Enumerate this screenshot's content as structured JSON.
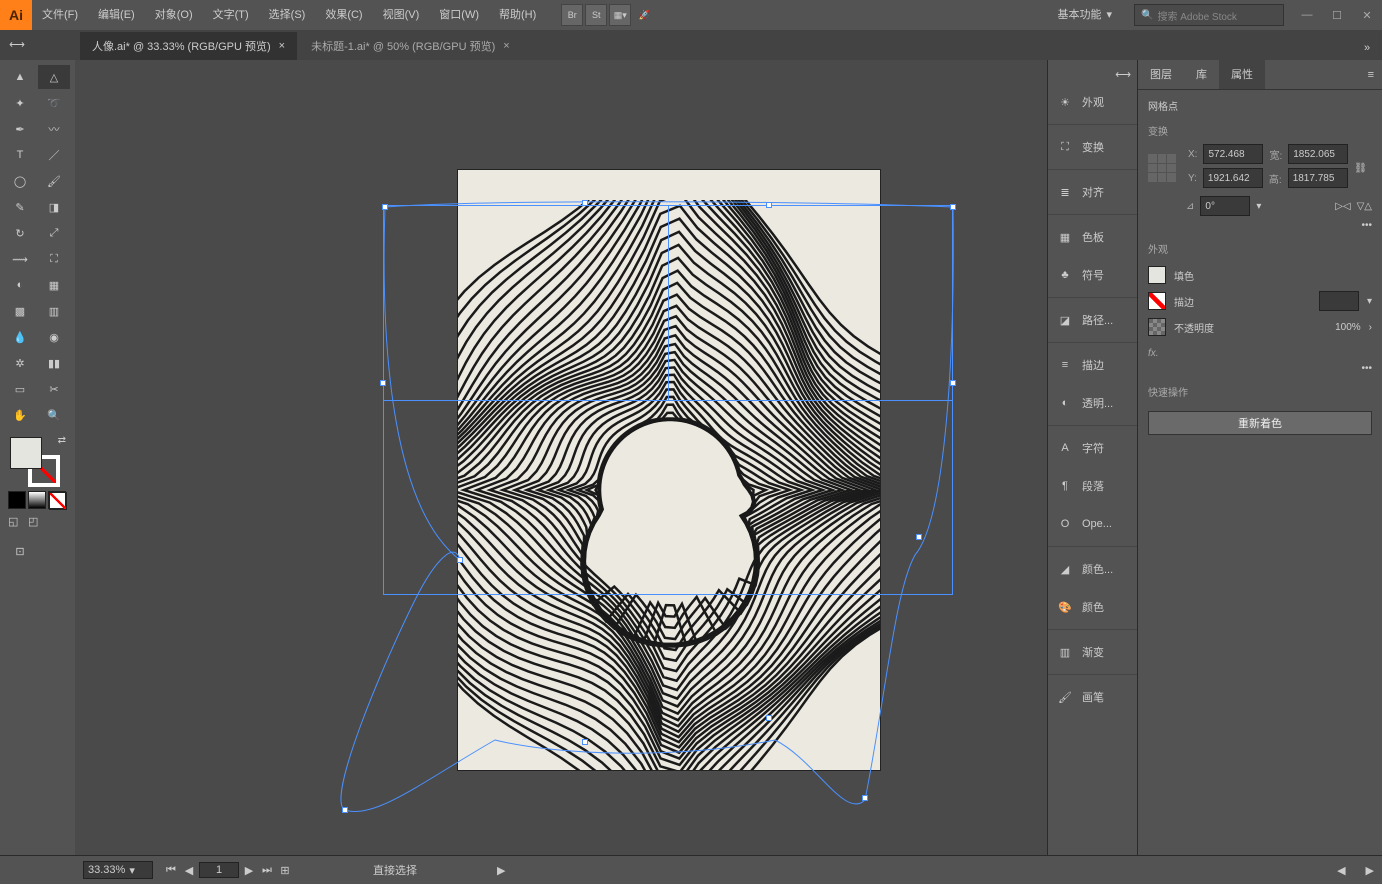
{
  "app": {
    "logo": "Ai"
  },
  "menu": [
    "文件(F)",
    "编辑(E)",
    "对象(O)",
    "文字(T)",
    "选择(S)",
    "效果(C)",
    "视图(V)",
    "窗口(W)",
    "帮助(H)"
  ],
  "top_icons": [
    "Br",
    "St"
  ],
  "workspace": "基本功能",
  "search_placeholder": "搜索 Adobe Stock",
  "tabs": [
    {
      "label": "人像.ai* @ 33.33% (RGB/GPU 预览)",
      "active": true
    },
    {
      "label": "未标题-1.ai* @ 50% (RGB/GPU 预览)",
      "active": false
    }
  ],
  "dock": [
    "外观",
    "变换",
    "对齐",
    "色板",
    "符号",
    "路径...",
    "描边",
    "透明...",
    "字符",
    "段落",
    "Ope...",
    "颜色...",
    "颜色",
    "渐变",
    "画笔"
  ],
  "props_tabs": [
    "图层",
    "库",
    "属性"
  ],
  "props_active": 2,
  "props": {
    "object_type": "网格点",
    "transform_title": "变换",
    "x_lbl": "X:",
    "y_lbl": "Y:",
    "w_lbl": "宽:",
    "h_lbl": "高:",
    "x": "572.468",
    "y": "1921.642",
    "w": "1852.065",
    "h": "1817.785",
    "angle_lbl": "⊿",
    "angle": "0°",
    "appearance_title": "外观",
    "fill_lbl": "填色",
    "stroke_lbl": "描边",
    "opacity_lbl": "不透明度",
    "opacity": "100%",
    "fx": "fx.",
    "quick_title": "快速操作",
    "recolor": "重新着色"
  },
  "status": {
    "zoom": "33.33%",
    "artboard": "1",
    "tool": "直接选择"
  }
}
